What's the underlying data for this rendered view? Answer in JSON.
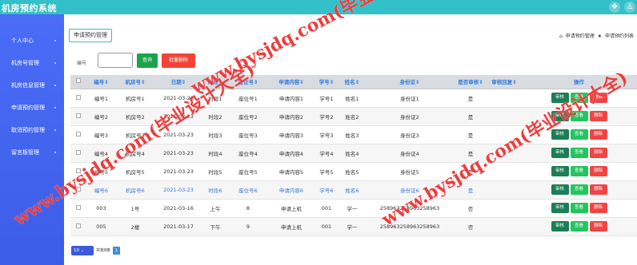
{
  "app": {
    "title": "机房预约系统"
  },
  "topbar": {
    "icons": [
      "move-icon",
      "user-icon"
    ]
  },
  "sidebar": {
    "items": [
      {
        "label": "个人中心"
      },
      {
        "label": "机房号管理"
      },
      {
        "label": "机房信息管理"
      },
      {
        "label": "申请预约管理"
      },
      {
        "label": "取消预约管理"
      },
      {
        "label": "留言板管理"
      }
    ]
  },
  "main": {
    "tab_label": "申请预约管理",
    "breadcrumb": [
      {
        "icon": "home-icon",
        "label": "申请预约管理"
      },
      {
        "icon": "star-icon",
        "label": "申请预约列表"
      }
    ]
  },
  "search": {
    "label": "编号",
    "value": "",
    "placeholder": "",
    "query_label": "查询",
    "bulk_delete_label": "批量删除"
  },
  "table": {
    "headers": [
      "编号",
      "机房号",
      "日期",
      "时段",
      "座位号",
      "申请内容",
      "学号",
      "姓名",
      "身份证",
      "是否审核",
      "审核回复",
      "操作"
    ],
    "action_labels": {
      "audit": "审核",
      "view": "查看",
      "delete": "删除"
    },
    "rows": [
      {
        "cells": [
          "编号1",
          "机房号1",
          "2021-03-23",
          "时段1",
          "座位号1",
          "申请内容1",
          "学号1",
          "姓名1",
          "身份证1",
          "是",
          ""
        ]
      },
      {
        "cells": [
          "编号2",
          "机房号2",
          "2021-03-23",
          "时段2",
          "座位号2",
          "申请内容2",
          "学号2",
          "姓名2",
          "身份证2",
          "是",
          ""
        ]
      },
      {
        "cells": [
          "编号3",
          "机房号3",
          "2021-03-23",
          "时段3",
          "座位号3",
          "申请内容3",
          "学号3",
          "姓名3",
          "身份证3",
          "是",
          ""
        ]
      },
      {
        "cells": [
          "编号4",
          "机房号4",
          "2021-03-23",
          "时段4",
          "座位号4",
          "申请内容4",
          "学号4",
          "姓名4",
          "身份证4",
          "是",
          ""
        ]
      },
      {
        "cells": [
          "编号5",
          "机房号5",
          "2021-03-23",
          "时段5",
          "座位号5",
          "申请内容5",
          "学号5",
          "姓名5",
          "身份证5",
          "是",
          ""
        ]
      },
      {
        "cells": [
          "编号6",
          "机房号6",
          "2021-03-23",
          "时段6",
          "座位号6",
          "申请内容6",
          "学号6",
          "姓名6",
          "身份证6",
          "是",
          ""
        ]
      },
      {
        "cells": [
          "003",
          "1号",
          "2021-03-16",
          "上午",
          "8",
          "申请上机",
          "001",
          "学一",
          "258963258963258963",
          "否",
          ""
        ]
      },
      {
        "cells": [
          "005",
          "2楼",
          "2021-03-17",
          "下午",
          "9",
          "申请上机",
          "001",
          "学一",
          "258963258963258963",
          "否",
          ""
        ]
      }
    ]
  },
  "pagination": {
    "page_size": "10",
    "total_text": "共有8条",
    "current_page": "1"
  },
  "watermark": {
    "text": "www.bysjdq.com(毕业设计大全)"
  }
}
